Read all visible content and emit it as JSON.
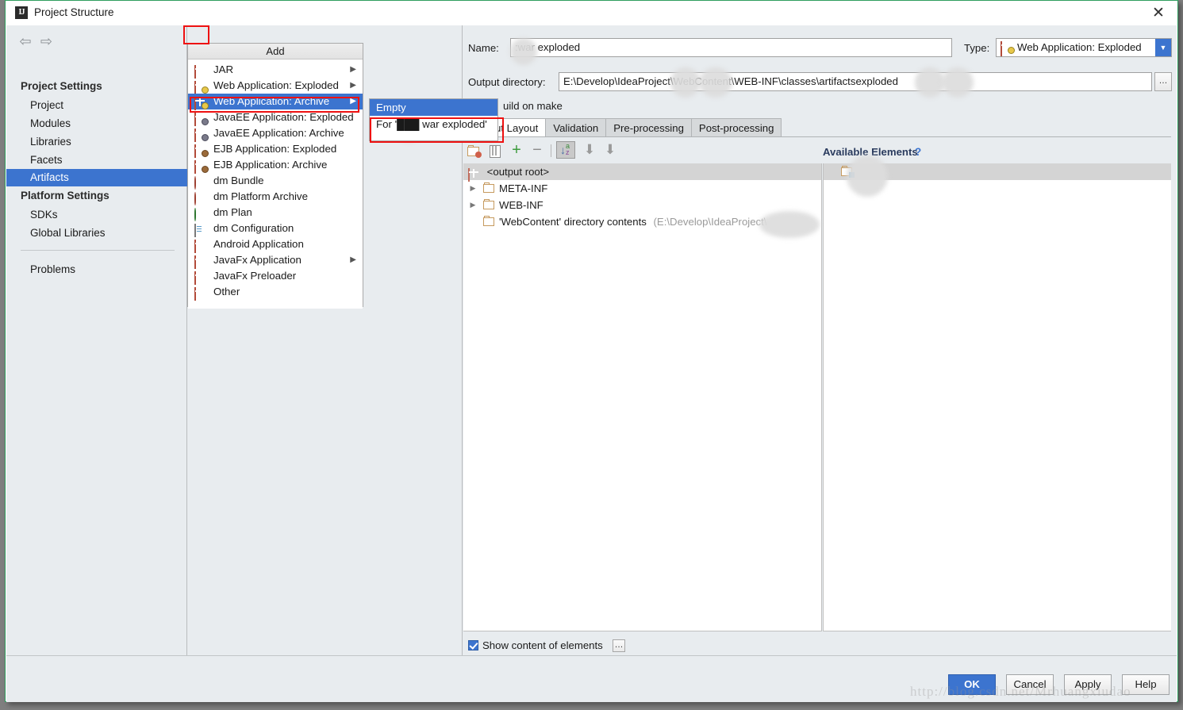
{
  "window": {
    "title": "Project Structure",
    "logo": "ij-logo",
    "close_label": "✕"
  },
  "toolbar": {
    "back_icon": "⇦",
    "forward_icon": "⇨",
    "add_label": "+",
    "remove_label": "−"
  },
  "sidebar": {
    "group_project": "Project Settings",
    "group_platform": "Platform Settings",
    "project_items": [
      "Project",
      "Modules",
      "Libraries",
      "Facets",
      "Artifacts"
    ],
    "platform_items": [
      "SDKs",
      "Global Libraries"
    ],
    "other_items": [
      "Problems"
    ],
    "selected": "Artifacts"
  },
  "add_menu": {
    "header": "Add",
    "items": [
      {
        "label": "JAR",
        "icon": "gift-icon",
        "has_submenu": true
      },
      {
        "label": "Web Application: Exploded",
        "icon": "gift-badge-icon",
        "has_submenu": true
      },
      {
        "label": "Web Application: Archive",
        "icon": "gift-badge-icon",
        "has_submenu": true,
        "selected": true
      },
      {
        "label": "JavaEE Application: Exploded",
        "icon": "gift-ee-icon",
        "has_submenu": false
      },
      {
        "label": "JavaEE Application: Archive",
        "icon": "gift-ee-icon",
        "has_submenu": false
      },
      {
        "label": "EJB Application: Exploded",
        "icon": "gift-ejb-icon",
        "has_submenu": false
      },
      {
        "label": "EJB Application: Archive",
        "icon": "gift-ejb-icon",
        "has_submenu": false
      },
      {
        "label": "dm Bundle",
        "icon": "dm-ball-icon",
        "has_submenu": false
      },
      {
        "label": "dm Platform Archive",
        "icon": "dm-ball-icon",
        "has_submenu": false
      },
      {
        "label": "dm Plan",
        "icon": "dm-green-icon",
        "has_submenu": false
      },
      {
        "label": "dm Configuration",
        "icon": "document-icon",
        "has_submenu": false
      },
      {
        "label": "Android Application",
        "icon": "gift-icon",
        "has_submenu": false
      },
      {
        "label": "JavaFx Application",
        "icon": "gift-icon",
        "has_submenu": true
      },
      {
        "label": "JavaFx Preloader",
        "icon": "gift-icon",
        "has_submenu": false
      },
      {
        "label": "Other",
        "icon": "gift-icon",
        "has_submenu": false
      }
    ]
  },
  "sub_menu": {
    "items": [
      {
        "label": "Empty",
        "selected": true
      },
      {
        "label": "For '███ war exploded'",
        "selected": false
      }
    ]
  },
  "artifact": {
    "name_label": "Name:",
    "name_value": ":war exploded",
    "type_label": "Type:",
    "type_value": "Web Application: Exploded",
    "type_icon": "gift-badge-icon",
    "type_arrow": "▼",
    "output_label": "Output directory:",
    "output_value_left": "E:\\Develop\\IdeaProject",
    "output_value_mid": "\\WebContent\\WEB-INF\\classes\\artifacts",
    "output_value_right": "exploded",
    "browse_label": "…",
    "build_on_make_label": "uild on make"
  },
  "tabs": [
    {
      "label": "ut Layout",
      "active": true
    },
    {
      "label": "Validation",
      "active": false
    },
    {
      "label": "Pre-processing",
      "active": false
    },
    {
      "label": "Post-processing",
      "active": false
    }
  ],
  "layout_toolbar": {
    "icons": [
      "create-directory-icon",
      "create-archive-icon",
      "add-copy-icon",
      "remove-icon",
      "sort-az-icon",
      "move-up-icon",
      "move-down-icon"
    ]
  },
  "tree": {
    "root_label": "<output root>",
    "root_icon": "gift-icon",
    "nodes": [
      {
        "label": "META-INF",
        "icon": "folder-icon",
        "expandable": true,
        "indent": 1
      },
      {
        "label": "WEB-INF",
        "icon": "folder-icon",
        "expandable": true,
        "indent": 1
      },
      {
        "label": "'WebContent' directory contents",
        "path": "(E:\\Develop\\IdeaProject\\",
        "path_close": ")",
        "icon": "folder-link-icon",
        "expandable": false,
        "indent": 1
      }
    ]
  },
  "available": {
    "title": "Available Elements",
    "help_icon": "?",
    "rows": [
      {
        "label": "",
        "icon": "module-folder-icon"
      }
    ]
  },
  "footer": {
    "show_content_label": "Show content of elements",
    "show_content_checked": true,
    "show_content_ellipsis": "…",
    "buttons": [
      {
        "label": "OK",
        "primary": true
      },
      {
        "label": "Cancel",
        "primary": false
      },
      {
        "label": "Apply",
        "primary": false
      },
      {
        "label": "Help",
        "primary": false
      }
    ]
  },
  "watermark": "http://blog.csdn.net/Mrhuangxiudao",
  "colors": {
    "selection_blue": "#3c74cf",
    "highlight_red": "#ee1111",
    "dialog_border_green": "#2f9e5e",
    "panel_bg": "#e8ecef",
    "tree_selected_gray": "#d4d4d4"
  }
}
